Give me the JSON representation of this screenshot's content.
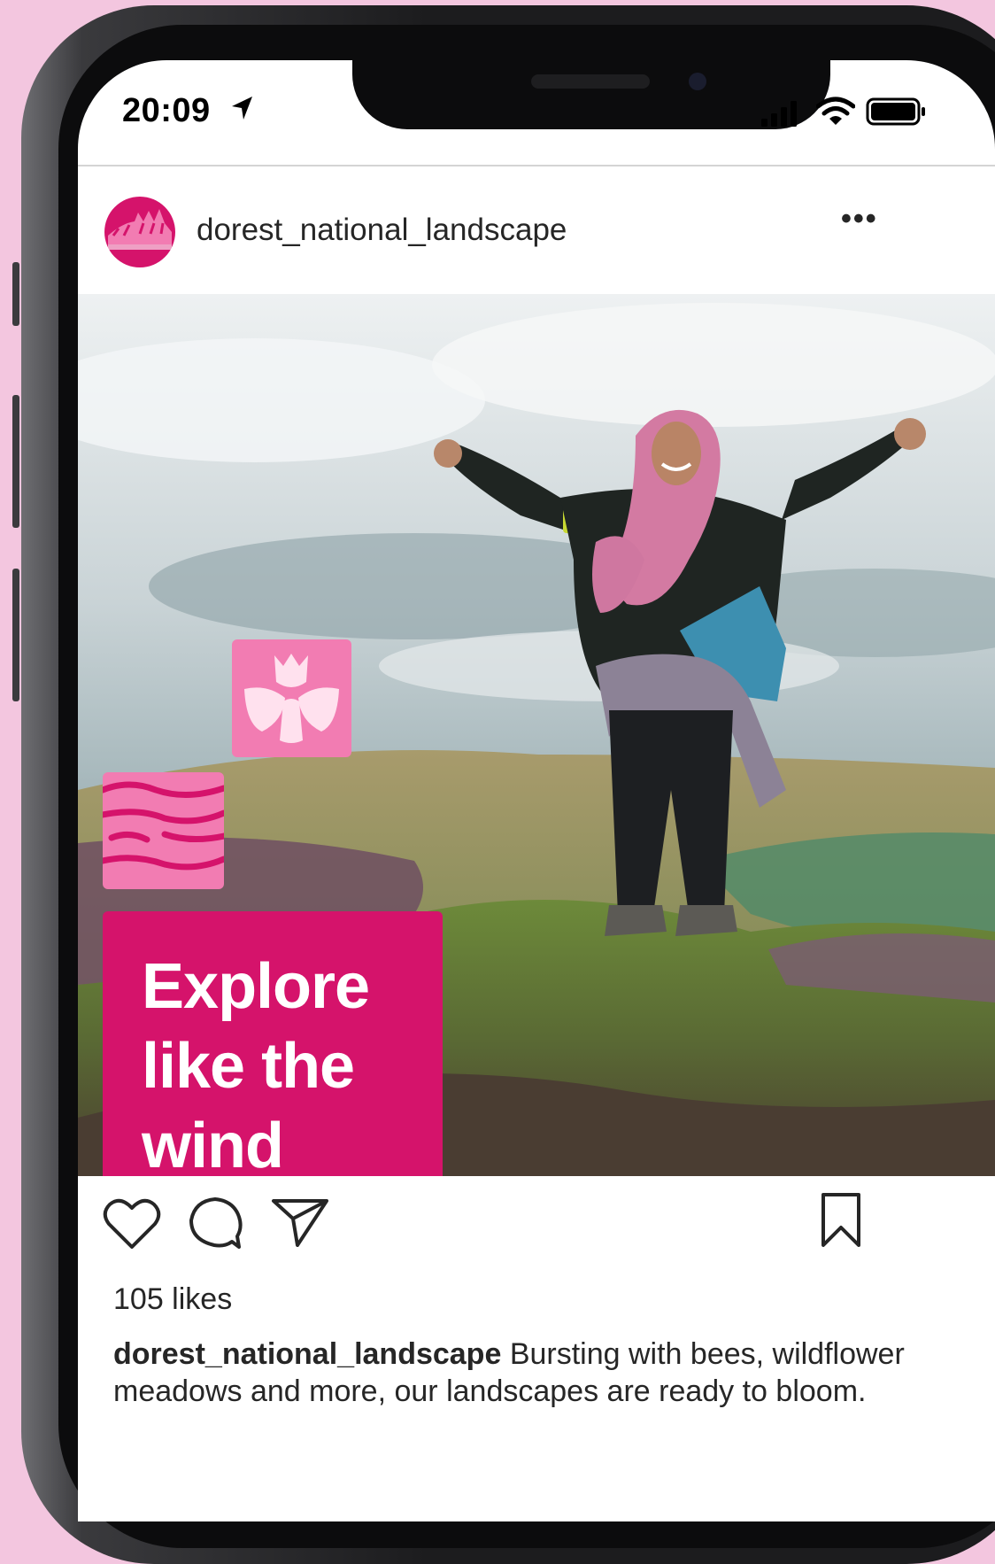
{
  "status_bar": {
    "time": "20:09"
  },
  "post": {
    "username": "dorest_national_landscape",
    "more_label": "•••",
    "headline_lines": [
      "Explore",
      "like the",
      "wind"
    ],
    "likes": "105 likes",
    "caption_user": "dorest_national_landscape",
    "caption_text": " Bursting with bees, wildflower meadows and more, our landscapes are ready to bloom."
  },
  "colors": {
    "brand": "#d5136b",
    "brand_light": "#f27cb2",
    "background": "#f3c6df",
    "text": "#262626"
  },
  "icons": [
    "location-arrow-icon",
    "cellular-signal-icon",
    "wifi-icon",
    "battery-icon",
    "more-options-icon",
    "heart-icon",
    "comment-icon",
    "share-icon",
    "bookmark-icon",
    "flower-icon",
    "waves-icon"
  ]
}
